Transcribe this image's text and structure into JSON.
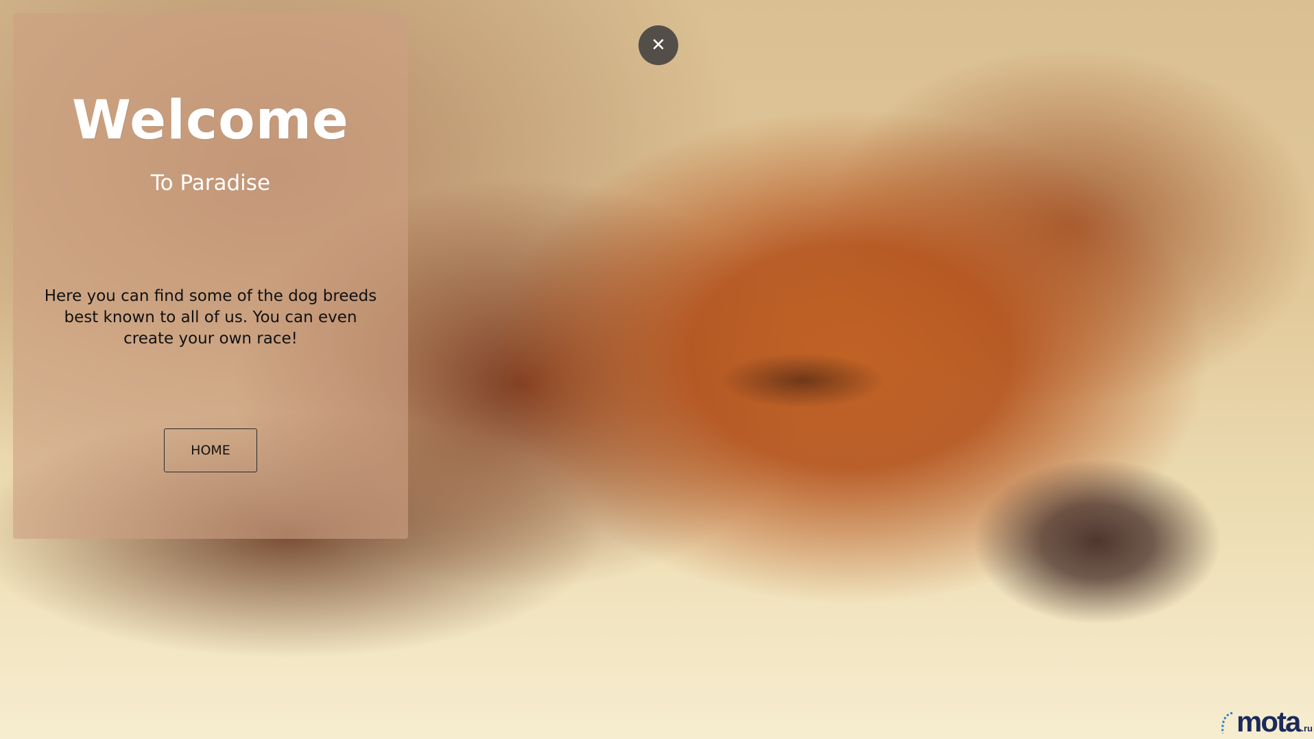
{
  "background": {
    "image_icon": "sleeping-dog-photo"
  },
  "close_button": {
    "label": "✕",
    "icon": "close-icon"
  },
  "card": {
    "title": "Welcome",
    "subtitle": "To Paradise",
    "description": "Here you can find some of the dog breeds best known to all of us. You can even create your own race!",
    "home_button_label": "HOME"
  },
  "watermark": {
    "text": "mota",
    "suffix": ".ru"
  },
  "colors": {
    "card_background": "#cda082",
    "close_button_background": "#3c3c3c",
    "title_color": "#ffffff",
    "text_color": "#111111",
    "watermark_color": "#1a2a5a"
  }
}
